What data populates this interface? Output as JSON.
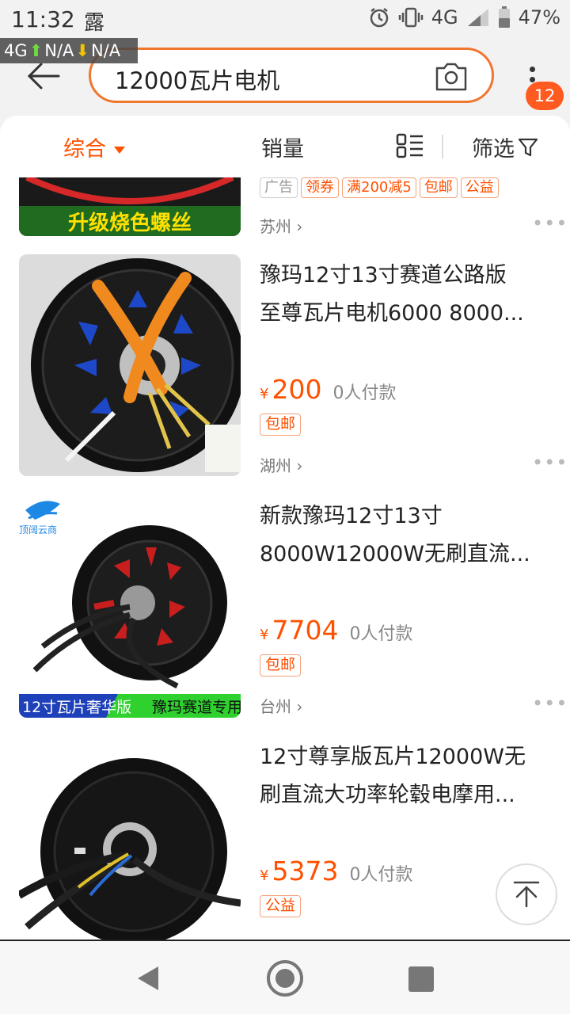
{
  "status_bar": {
    "time": "11:32",
    "dew": "露",
    "network": "4G",
    "battery": "47%",
    "net_overlay": {
      "type": "4G",
      "up": "N/A",
      "down": "N/A"
    }
  },
  "search": {
    "query": "12000瓦片电机",
    "badge_count": "12"
  },
  "sort_bar": {
    "comprehensive": "综合",
    "sales": "销量",
    "filter": "筛选"
  },
  "items": [
    {
      "thumb_text": "升级烧色螺丝",
      "tags": [
        "广告",
        "领券",
        "满200减5",
        "包邮",
        "公益"
      ],
      "location": "苏州 ›"
    },
    {
      "title_line1": "豫玛12寸13寸赛道公路版",
      "title_line2": "至尊瓦片电机6000 8000...",
      "price_symbol": "¥",
      "price": "200",
      "paid": "0人付款",
      "tag": "包邮",
      "location": "湖州 ›"
    },
    {
      "title_line1": "新款豫玛12寸13寸",
      "title_line2": "8000W12000W无刷直流...",
      "price_symbol": "¥",
      "price": "7704",
      "paid": "0人付款",
      "tag": "包邮",
      "location": "台州 ›",
      "thumb_brand": "顶阔云商",
      "thumb_banner_left": "12寸瓦片奢华版",
      "thumb_banner_right": "豫玛赛道专用"
    },
    {
      "title_line1": "12寸尊享版瓦片12000W无",
      "title_line2": "刷直流大功率轮毂电摩用...",
      "price_symbol": "¥",
      "price": "5373",
      "paid": "0人付款",
      "tag": "公益"
    }
  ],
  "more_dots": "•••",
  "colors": {
    "accent": "#ff5000",
    "search_border": "#f0772f",
    "badge": "#ff5a1f"
  }
}
